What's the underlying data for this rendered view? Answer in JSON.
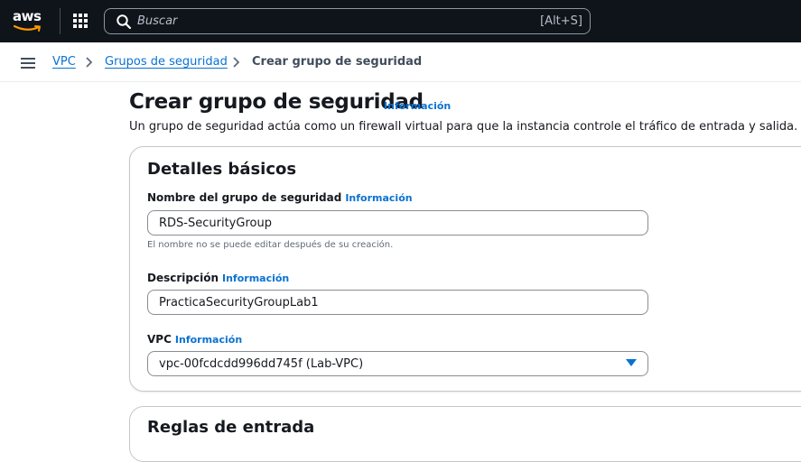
{
  "topbar": {
    "logo_text": "aws",
    "search_placeholder": "Buscar",
    "search_shortcut": "[Alt+S]"
  },
  "breadcrumb": {
    "items": [
      {
        "label": "VPC"
      },
      {
        "label": "Grupos de seguridad"
      },
      {
        "label": "Crear grupo de seguridad"
      }
    ]
  },
  "page": {
    "title": "Crear grupo de seguridad",
    "info_link": "Información",
    "description": "Un grupo de seguridad actúa como un firewall virtual para que la instancia controle el tráfico de entrada y salida. Para"
  },
  "basic_details": {
    "title": "Detalles básicos",
    "name_field": {
      "label": "Nombre del grupo de seguridad",
      "info": "Información",
      "value": "RDS-SecurityGroup",
      "hint": "El nombre no se puede editar después de su creación."
    },
    "description_field": {
      "label": "Descripción",
      "info": "Información",
      "value": "PracticaSecurityGroupLab1"
    },
    "vpc_field": {
      "label": "VPC",
      "info": "Información",
      "value": "vpc-00fcdcdd996dd745f (Lab-VPC)"
    }
  },
  "next_section": {
    "title": "Reglas de entrada"
  },
  "colors": {
    "topbar_bg": "#0f141a",
    "link": "#0972d3",
    "text": "#16191f"
  }
}
